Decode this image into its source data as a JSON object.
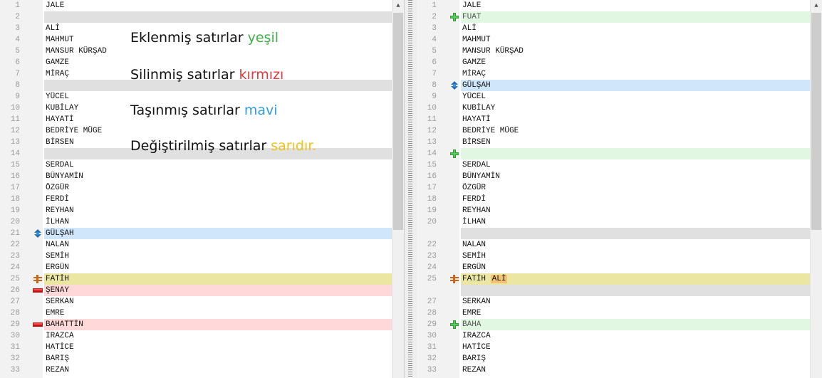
{
  "legend": {
    "added_prefix": "Eklenmiş satırlar ",
    "added_color_word": "yeşil",
    "removed_prefix": "Silinmiş satırlar ",
    "removed_color_word": "kırmızı",
    "moved_prefix": "Taşınmış satırlar ",
    "moved_color_word": "mavi",
    "changed_prefix": "Değiştirilmiş satırlar ",
    "changed_color_word": "sarıdır."
  },
  "colors": {
    "added": "#e2f7e2",
    "removed": "#ffd9d9",
    "moved": "#cfe6fb",
    "changed": "#ece6a3",
    "gap": "#e0e0e0"
  },
  "left": [
    {
      "n": "1",
      "t": "JALE",
      "s": ""
    },
    {
      "n": "2",
      "t": "",
      "s": "gap"
    },
    {
      "n": "3",
      "t": "ALİ",
      "s": ""
    },
    {
      "n": "4",
      "t": "MAHMUT",
      "s": ""
    },
    {
      "n": "5",
      "t": "MANSUR KÜRŞAD",
      "s": ""
    },
    {
      "n": "6",
      "t": "GAMZE",
      "s": ""
    },
    {
      "n": "7",
      "t": "MİRAÇ",
      "s": ""
    },
    {
      "n": "8",
      "t": "",
      "s": "gap"
    },
    {
      "n": "9",
      "t": "YÜCEL",
      "s": ""
    },
    {
      "n": "10",
      "t": "KUBİLAY",
      "s": ""
    },
    {
      "n": "11",
      "t": "HAYATİ",
      "s": ""
    },
    {
      "n": "12",
      "t": "BEDRİYE MÜGE",
      "s": ""
    },
    {
      "n": "13",
      "t": "BİRSEN",
      "s": ""
    },
    {
      "n": "14",
      "t": "",
      "s": "gap"
    },
    {
      "n": "15",
      "t": "SERDAL",
      "s": ""
    },
    {
      "n": "16",
      "t": "BÜNYAMİN",
      "s": ""
    },
    {
      "n": "17",
      "t": "ÖZGÜR",
      "s": ""
    },
    {
      "n": "18",
      "t": "FERDİ",
      "s": ""
    },
    {
      "n": "19",
      "t": "REYHAN",
      "s": ""
    },
    {
      "n": "20",
      "t": "İLHAN",
      "s": ""
    },
    {
      "n": "21",
      "t": "GÜLŞAH",
      "s": "moved"
    },
    {
      "n": "22",
      "t": "NALAN",
      "s": ""
    },
    {
      "n": "23",
      "t": "SEMİH",
      "s": ""
    },
    {
      "n": "24",
      "t": "ERGÜN",
      "s": ""
    },
    {
      "n": "25",
      "t": "FATİH",
      "s": "changed"
    },
    {
      "n": "26",
      "t": "ŞENAY",
      "s": "removed"
    },
    {
      "n": "27",
      "t": "SERKAN",
      "s": ""
    },
    {
      "n": "28",
      "t": "EMRE",
      "s": ""
    },
    {
      "n": "29",
      "t": "BAHATTİN",
      "s": "removed"
    },
    {
      "n": "30",
      "t": "IRAZCA",
      "s": ""
    },
    {
      "n": "31",
      "t": "HATİCE",
      "s": ""
    },
    {
      "n": "32",
      "t": "BARIŞ",
      "s": ""
    },
    {
      "n": "33",
      "t": "REZAN",
      "s": ""
    }
  ],
  "right": [
    {
      "n": "1",
      "t": "JALE",
      "s": ""
    },
    {
      "n": "2",
      "t": "FUAT",
      "s": "added"
    },
    {
      "n": "3",
      "t": "ALİ",
      "s": ""
    },
    {
      "n": "4",
      "t": "MAHMUT",
      "s": ""
    },
    {
      "n": "5",
      "t": "MANSUR KÜRŞAD",
      "s": ""
    },
    {
      "n": "6",
      "t": "GAMZE",
      "s": ""
    },
    {
      "n": "7",
      "t": "MİRAÇ",
      "s": ""
    },
    {
      "n": "8",
      "t": "GÜLŞAH",
      "s": "moved"
    },
    {
      "n": "9",
      "t": "YÜCEL",
      "s": ""
    },
    {
      "n": "10",
      "t": "KUBİLAY",
      "s": ""
    },
    {
      "n": "11",
      "t": "HAYATİ",
      "s": ""
    },
    {
      "n": "12",
      "t": "BEDRİYE MÜGE",
      "s": ""
    },
    {
      "n": "13",
      "t": "BİRSEN",
      "s": ""
    },
    {
      "n": "14",
      "t": "",
      "s": "added"
    },
    {
      "n": "15",
      "t": "SERDAL",
      "s": ""
    },
    {
      "n": "16",
      "t": "BÜNYAMİN",
      "s": ""
    },
    {
      "n": "17",
      "t": "ÖZGÜR",
      "s": ""
    },
    {
      "n": "18",
      "t": "FERDİ",
      "s": ""
    },
    {
      "n": "19",
      "t": "REYHAN",
      "s": ""
    },
    {
      "n": "20",
      "t": "İLHAN",
      "s": ""
    },
    {
      "n": "",
      "t": "",
      "s": "gap"
    },
    {
      "n": "22",
      "t": "NALAN",
      "s": ""
    },
    {
      "n": "23",
      "t": "SEMİH",
      "s": ""
    },
    {
      "n": "24",
      "t": "ERGÜN",
      "s": ""
    },
    {
      "n": "25",
      "t": "FATİH",
      "t2": "ALİ",
      "s": "changed"
    },
    {
      "n": "",
      "t": "",
      "s": "gap"
    },
    {
      "n": "27",
      "t": "SERKAN",
      "s": ""
    },
    {
      "n": "28",
      "t": "EMRE",
      "s": ""
    },
    {
      "n": "29",
      "t": "BAHA",
      "s": "added"
    },
    {
      "n": "30",
      "t": "IRAZCA",
      "s": ""
    },
    {
      "n": "31",
      "t": "HATİCE",
      "s": ""
    },
    {
      "n": "32",
      "t": "BARIŞ",
      "s": ""
    },
    {
      "n": "33",
      "t": "REZAN",
      "s": ""
    }
  ]
}
